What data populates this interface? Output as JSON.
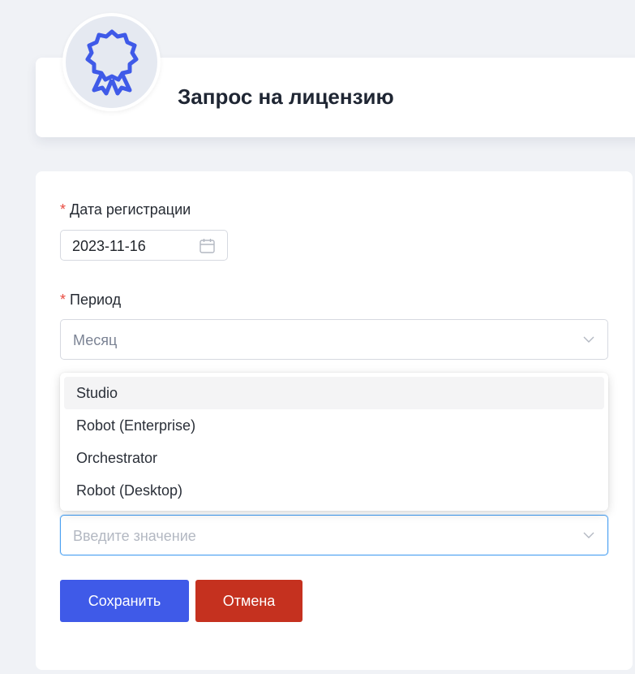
{
  "header": {
    "title": "Запрос на лицензию",
    "icon": "award-ribbon-icon",
    "accent": "#3f5ae8"
  },
  "form": {
    "registration_date": {
      "label": "Дата регистрации",
      "required_mark": "*",
      "value": "2023-11-16"
    },
    "period": {
      "label": "Период",
      "required_mark": "*",
      "value": "Месяц"
    },
    "product": {
      "placeholder": "Введите значение",
      "options": [
        "Studio",
        "Robot (Enterprise)",
        "Orchestrator",
        "Robot (Desktop)"
      ],
      "highlighted_option": "Studio"
    }
  },
  "actions": {
    "save_label": "Сохранить",
    "cancel_label": "Отмена",
    "save_color": "#3f5ae8",
    "cancel_color": "#c5311f"
  }
}
